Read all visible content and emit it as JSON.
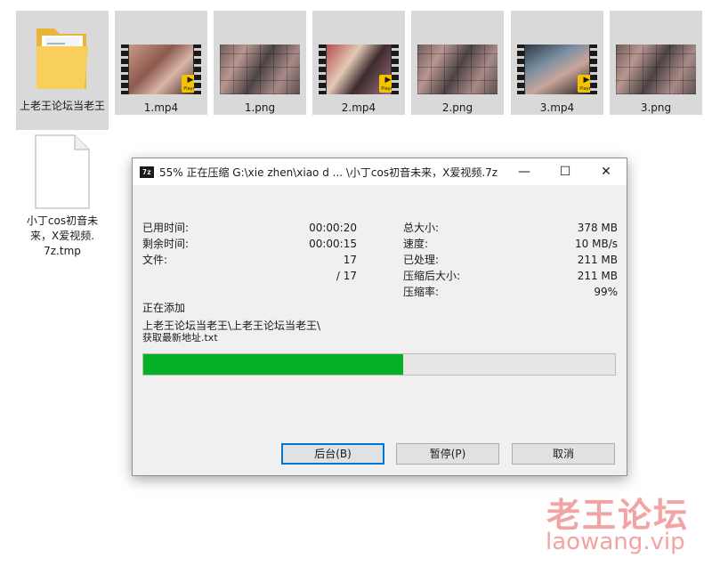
{
  "explorer": {
    "items": [
      {
        "label": "上老王论坛当老王",
        "type": "folder"
      },
      {
        "label": "1.mp4",
        "type": "video"
      },
      {
        "label": "1.png",
        "type": "image"
      },
      {
        "label": "2.mp4",
        "type": "video"
      },
      {
        "label": "2.png",
        "type": "image"
      },
      {
        "label": "3.mp4",
        "type": "video"
      },
      {
        "label": "3.png",
        "type": "image"
      }
    ],
    "player_badge": "Player",
    "temp_file": {
      "line1": "小丁cos初音未",
      "line2": "来，X爱视频.",
      "line3": "7z.tmp"
    }
  },
  "dialog": {
    "app_icon": "7z",
    "title": "55% 正在压缩 G:\\xie zhen\\xiao d ... \\小丁cos初音未来，X爱视频.7z",
    "window_buttons": {
      "minimize": "—",
      "maximize": "☐",
      "close": "✕"
    },
    "stats_left": [
      {
        "label": "已用时间:",
        "value": "00:00:20"
      },
      {
        "label": "剩余时间:",
        "value": "00:00:15"
      },
      {
        "label": "文件:",
        "value": "17"
      },
      {
        "label": "",
        "value": "/ 17"
      }
    ],
    "stats_right": [
      {
        "label": "总大小:",
        "value": "378 MB"
      },
      {
        "label": "速度:",
        "value": "10 MB/s"
      },
      {
        "label": "已处理:",
        "value": "211 MB"
      },
      {
        "label": "压缩后大小:",
        "value": "211 MB"
      },
      {
        "label": "压缩率:",
        "value": "99%"
      }
    ],
    "status_title": "正在添加",
    "current_path_line1": "上老王论坛当老王\\上老王论坛当老王\\",
    "current_path_line2": "获取最新地址.txt",
    "progress_percent": 55,
    "buttons": {
      "background": "后台(B)",
      "pause": "暂停(P)",
      "cancel": "取消"
    }
  },
  "watermark": {
    "cn": "老王论坛",
    "en": "laowang.vip"
  },
  "colors": {
    "progress": "#06b025",
    "selection": "#d9d9d9",
    "watermark": "#f2a3a3"
  }
}
